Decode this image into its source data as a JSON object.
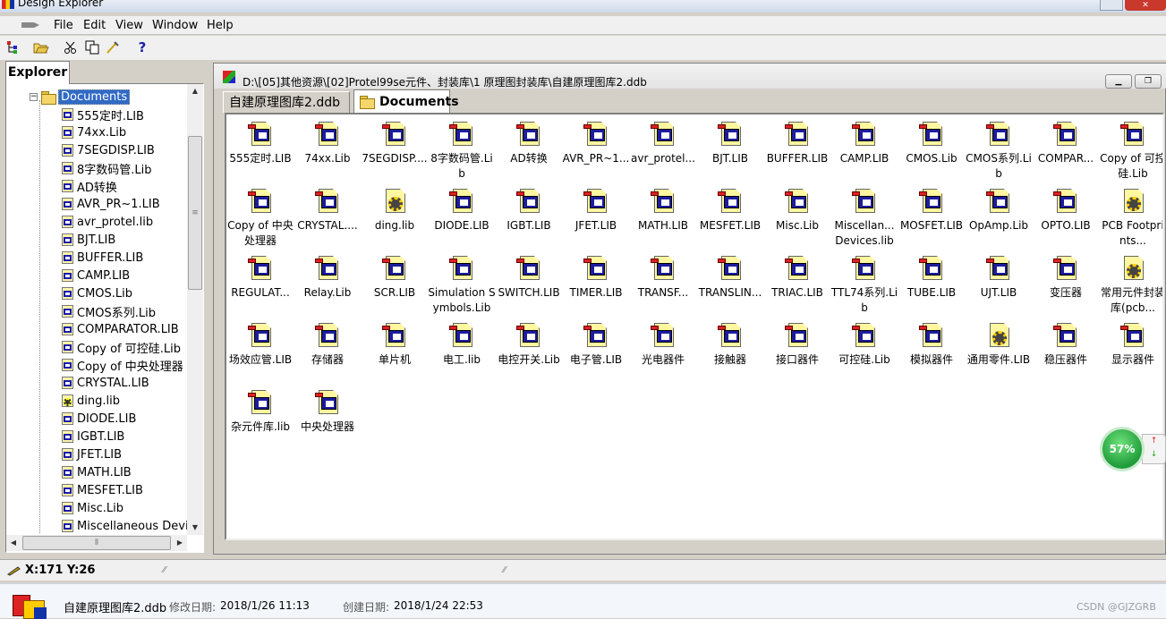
{
  "app": {
    "title": "Design Explorer"
  },
  "menu": [
    "File",
    "Edit",
    "View",
    "Window",
    "Help"
  ],
  "toolbar": {
    "help_label": "?"
  },
  "explorer": {
    "tab_label": "Explorer",
    "root_label": "Documents",
    "items": [
      {
        "label": "555定时.LIB",
        "icon": "schlib-icon"
      },
      {
        "label": "74xx.Lib",
        "icon": "schlib-icon"
      },
      {
        "label": "7SEGDISP.LIB",
        "icon": "schlib-icon"
      },
      {
        "label": "8字数码管.Lib",
        "icon": "schlib-icon"
      },
      {
        "label": "AD转换",
        "icon": "schlib-icon"
      },
      {
        "label": "AVR_PR~1.LIB",
        "icon": "schlib-icon"
      },
      {
        "label": "avr_protel.lib",
        "icon": "schlib-icon"
      },
      {
        "label": "BJT.LIB",
        "icon": "schlib-icon"
      },
      {
        "label": "BUFFER.LIB",
        "icon": "schlib-icon"
      },
      {
        "label": "CAMP.LIB",
        "icon": "schlib-icon"
      },
      {
        "label": "CMOS.Lib",
        "icon": "schlib-icon"
      },
      {
        "label": "CMOS系列.Lib",
        "icon": "schlib-icon"
      },
      {
        "label": "COMPARATOR.LIB",
        "icon": "schlib-icon"
      },
      {
        "label": "Copy of 可控硅.Lib",
        "icon": "schlib-icon"
      },
      {
        "label": "Copy of 中央处理器",
        "icon": "schlib-icon"
      },
      {
        "label": "CRYSTAL.LIB",
        "icon": "schlib-icon"
      },
      {
        "label": "ding.lib",
        "icon": "pcblib-icon"
      },
      {
        "label": "DIODE.LIB",
        "icon": "schlib-icon"
      },
      {
        "label": "IGBT.LIB",
        "icon": "schlib-icon"
      },
      {
        "label": "JFET.LIB",
        "icon": "schlib-icon"
      },
      {
        "label": "MATH.LIB",
        "icon": "schlib-icon"
      },
      {
        "label": "MESFET.LIB",
        "icon": "schlib-icon"
      },
      {
        "label": "Misc.Lib",
        "icon": "schlib-icon"
      },
      {
        "label": "Miscellaneous Devic",
        "icon": "schlib-icon"
      }
    ]
  },
  "document": {
    "path": "D:\\[05]其他资源\\[02]Protel99se元件、封装库\\1 原理图封装库\\自建原理图库2.ddb",
    "tabs": [
      {
        "label": "自建原理图库2.ddb",
        "active": false
      },
      {
        "label": "Documents",
        "active": true
      }
    ],
    "files": [
      {
        "label": "555定时.LIB",
        "icon": "schlib-icon"
      },
      {
        "label": "74xx.Lib",
        "icon": "schlib-icon"
      },
      {
        "label": "7SEGDISP....",
        "icon": "schlib-icon"
      },
      {
        "label": "8字数码管.Lib",
        "icon": "schlib-icon"
      },
      {
        "label": "AD转换",
        "icon": "schlib-icon"
      },
      {
        "label": "AVR_PR~1...",
        "icon": "schlib-icon"
      },
      {
        "label": "avr_protel...",
        "icon": "schlib-icon"
      },
      {
        "label": "BJT.LIB",
        "icon": "schlib-icon"
      },
      {
        "label": "BUFFER.LIB",
        "icon": "schlib-icon"
      },
      {
        "label": "CAMP.LIB",
        "icon": "schlib-icon"
      },
      {
        "label": "CMOS.Lib",
        "icon": "schlib-icon"
      },
      {
        "label": "CMOS系列.Lib",
        "icon": "schlib-icon"
      },
      {
        "label": "COMPAR...",
        "icon": "schlib-icon"
      },
      {
        "label": "Copy of 可控硅.Lib",
        "icon": "schlib-icon"
      },
      {
        "label": "Copy of 中央处理器",
        "icon": "schlib-icon"
      },
      {
        "label": "CRYSTAL....",
        "icon": "schlib-icon"
      },
      {
        "label": "ding.lib",
        "icon": "pcblib-icon"
      },
      {
        "label": "DIODE.LIB",
        "icon": "schlib-icon"
      },
      {
        "label": "IGBT.LIB",
        "icon": "schlib-icon"
      },
      {
        "label": "JFET.LIB",
        "icon": "schlib-icon"
      },
      {
        "label": "MATH.LIB",
        "icon": "schlib-icon"
      },
      {
        "label": "MESFET.LIB",
        "icon": "schlib-icon"
      },
      {
        "label": "Misc.Lib",
        "icon": "schlib-icon"
      },
      {
        "label": "Miscellan... Devices.lib",
        "icon": "schlib-icon"
      },
      {
        "label": "MOSFET.LIB",
        "icon": "schlib-icon"
      },
      {
        "label": "OpAmp.Lib",
        "icon": "schlib-icon"
      },
      {
        "label": "OPTO.LIB",
        "icon": "schlib-icon"
      },
      {
        "label": "PCB Footprints...",
        "icon": "pcblib-icon"
      },
      {
        "label": "REGULAT...",
        "icon": "schlib-icon"
      },
      {
        "label": "Relay.Lib",
        "icon": "schlib-icon"
      },
      {
        "label": "SCR.LIB",
        "icon": "schlib-icon"
      },
      {
        "label": "Simulation Symbols.Lib",
        "icon": "schlib-icon"
      },
      {
        "label": "SWITCH.LIB",
        "icon": "schlib-icon"
      },
      {
        "label": "TIMER.LIB",
        "icon": "schlib-icon"
      },
      {
        "label": "TRANSF...",
        "icon": "schlib-icon"
      },
      {
        "label": "TRANSLIN...",
        "icon": "schlib-icon"
      },
      {
        "label": "TRIAC.LIB",
        "icon": "schlib-icon"
      },
      {
        "label": "TTL74系列.Lib",
        "icon": "schlib-icon"
      },
      {
        "label": "TUBE.LIB",
        "icon": "schlib-icon"
      },
      {
        "label": "UJT.LIB",
        "icon": "schlib-icon"
      },
      {
        "label": "变压器",
        "icon": "schlib-icon"
      },
      {
        "label": "常用元件封装库(pcb...",
        "icon": "pcblib-icon"
      },
      {
        "label": "场效应管.LIB",
        "icon": "schlib-icon"
      },
      {
        "label": "存储器",
        "icon": "schlib-icon"
      },
      {
        "label": "单片机",
        "icon": "schlib-icon"
      },
      {
        "label": "电工.lib",
        "icon": "schlib-icon"
      },
      {
        "label": "电控开关.Lib",
        "icon": "schlib-icon"
      },
      {
        "label": "电子管.LIB",
        "icon": "schlib-icon"
      },
      {
        "label": "光电器件",
        "icon": "schlib-icon"
      },
      {
        "label": "接触器",
        "icon": "schlib-icon"
      },
      {
        "label": "接口器件",
        "icon": "schlib-icon"
      },
      {
        "label": "可控硅.Lib",
        "icon": "schlib-icon"
      },
      {
        "label": "模拟器件",
        "icon": "schlib-icon"
      },
      {
        "label": "通用零件.LIB",
        "icon": "pcblib-icon"
      },
      {
        "label": "稳压器件",
        "icon": "schlib-icon"
      },
      {
        "label": "显示器件",
        "icon": "schlib-icon"
      },
      {
        "label": "杂元件库.lib",
        "icon": "schlib-icon"
      },
      {
        "label": "中央处理器",
        "icon": "schlib-icon"
      }
    ]
  },
  "status": {
    "coords": "X:171 Y:26"
  },
  "badge": {
    "percent": "57%",
    "color": "#1f9d3a"
  },
  "fileinfo": {
    "name": "自建原理图库2.ddb",
    "modified_label": "修改日期:",
    "modified": "2018/1/26 11:13",
    "created_label": "创建日期:",
    "created": "2018/1/24 22:53"
  },
  "watermark": "CSDN @GJZGRB"
}
